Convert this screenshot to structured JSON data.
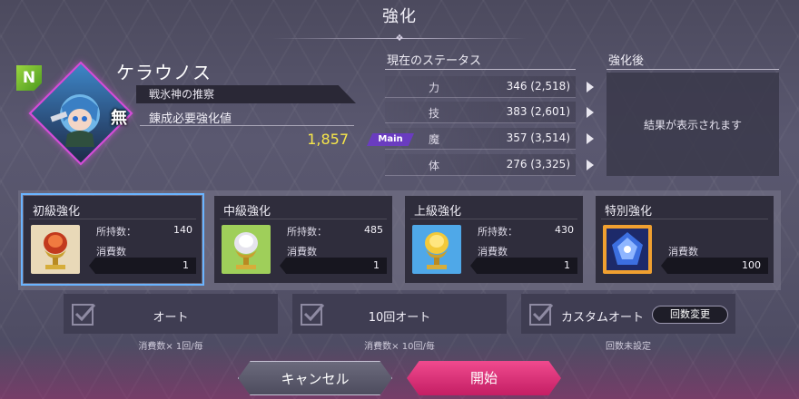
{
  "header": {
    "title": "強化"
  },
  "character": {
    "rarity_badge": "N",
    "element_badge": "無",
    "name": "ケラウノス",
    "subtitle": "戦氷神の推察",
    "required_label": "錬成必要強化値",
    "required_value": "1,857"
  },
  "status": {
    "title": "現在のステータス",
    "main_tag": "Main",
    "rows": [
      {
        "name": "力",
        "value": "346 (2,518)"
      },
      {
        "name": "技",
        "value": "383 (2,601)"
      },
      {
        "name": "魔",
        "value": "357 (3,514)"
      },
      {
        "name": "体",
        "value": "276 (3,325)"
      }
    ]
  },
  "after": {
    "title": "強化後",
    "placeholder": "結果が表示されます"
  },
  "enhance": {
    "owned_label": "所持数：",
    "consume_label": "消費数",
    "cards": [
      {
        "title": "初級強化",
        "owned": "140",
        "consume": "1",
        "icon": "red-chalice-icon",
        "selected": true
      },
      {
        "title": "中級強化",
        "owned": "485",
        "consume": "1",
        "icon": "green-chalice-icon",
        "selected": false
      },
      {
        "title": "上級強化",
        "owned": "430",
        "consume": "1",
        "icon": "blue-chalice-icon",
        "selected": false
      },
      {
        "title": "特別強化",
        "owned": "",
        "consume": "100",
        "icon": "blue-gem-icon",
        "selected": false
      }
    ]
  },
  "auto": {
    "buttons": [
      {
        "label": "オート",
        "note": "消費数× 1回/毎"
      },
      {
        "label": "10回オート",
        "note": "消費数× 10回/毎"
      },
      {
        "label": "カスタムオート",
        "note": "回数未設定"
      }
    ],
    "custom_change_label": "回数変更"
  },
  "footer": {
    "cancel_label": "キャンセル",
    "start_label": "開始"
  },
  "colors": {
    "accent_pink": "#e8317a",
    "selected_outline": "#6ab4ff",
    "value_yellow": "#f7e64a",
    "main_tag": "#6a3cc0",
    "rarity_green": "#7cc236"
  }
}
